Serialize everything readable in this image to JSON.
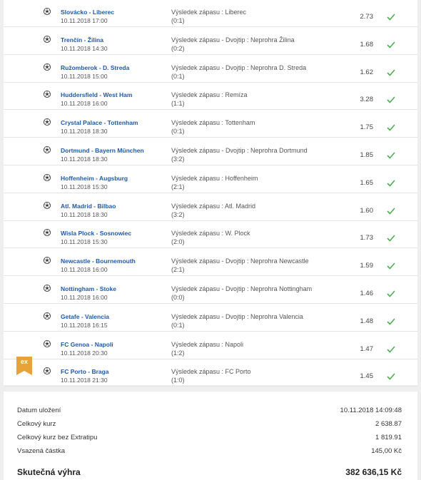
{
  "ticket": {
    "rows": [
      {
        "match": "Slovácko - Liberec",
        "date": "10.11.2018 17:00",
        "bet": "Výsledek zápasu : Liberec",
        "score": "(0:1)",
        "odds": "2.73",
        "extra": false
      },
      {
        "match": "Trenčín - Žilina",
        "date": "10.11.2018 14:30",
        "bet": "Výsledek zápasu - Dvojtip : Neprohra Žilina",
        "score": "(0:2)",
        "odds": "1.68",
        "extra": false
      },
      {
        "match": "Ružomberok - D. Streda",
        "date": "10.11.2018 15:00",
        "bet": "Výsledek zápasu - Dvojtip : Neprohra D. Streda",
        "score": "(0:1)",
        "odds": "1.62",
        "extra": false
      },
      {
        "match": "Huddersfield - West Ham",
        "date": "10.11.2018 16:00",
        "bet": "Výsledek zápasu : Remíza",
        "score": "(1:1)",
        "odds": "3.28",
        "extra": false
      },
      {
        "match": "Crystal Palace - Tottenham",
        "date": "10.11.2018 18:30",
        "bet": "Výsledek zápasu : Tottenham",
        "score": "(0:1)",
        "odds": "1.75",
        "extra": false
      },
      {
        "match": "Dortmund - Bayern München",
        "date": "10.11.2018 18:30",
        "bet": "Výsledek zápasu - Dvojtip : Neprohra Dortmund",
        "score": "(3:2)",
        "odds": "1.85",
        "extra": false
      },
      {
        "match": "Hoffenheim - Augsburg",
        "date": "10.11.2018 15:30",
        "bet": "Výsledek zápasu : Hoffenheim",
        "score": "(2:1)",
        "odds": "1.65",
        "extra": false
      },
      {
        "match": "Atl. Madrid - Bilbao",
        "date": "10.11.2018 18:30",
        "bet": "Výsledek zápasu : Atl. Madrid",
        "score": "(3:2)",
        "odds": "1.60",
        "extra": false
      },
      {
        "match": "Wisla Plock - Sosnowiec",
        "date": "10.11.2018 15:30",
        "bet": "Výsledek zápasu : W. Plock",
        "score": "(2:0)",
        "odds": "1.73",
        "extra": false
      },
      {
        "match": "Newcastle - Bournemouth",
        "date": "10.11.2018 16:00",
        "bet": "Výsledek zápasu - Dvojtip : Neprohra Newcastle",
        "score": "(2:1)",
        "odds": "1.59",
        "extra": false
      },
      {
        "match": "Nottingham - Stoke",
        "date": "10.11.2018 16:00",
        "bet": "Výsledek zápasu - Dvojtip : Neprohra Nottingham",
        "score": "(0:0)",
        "odds": "1.46",
        "extra": false
      },
      {
        "match": "Getafe - Valencia",
        "date": "10.11.2018 16:15",
        "bet": "Výsledek zápasu - Dvojtip : Neprohra Valencia",
        "score": "(0:1)",
        "odds": "1.48",
        "extra": false
      },
      {
        "match": "FC Genoa - Napoli",
        "date": "10.11.2018 20:30",
        "bet": "Výsledek zápasu : Napoli",
        "score": "(1:2)",
        "odds": "1.47",
        "extra": false
      },
      {
        "match": "FC Porto - Braga",
        "date": "10.11.2018 21:30",
        "bet": "Výsledek zápasu : FC Porto",
        "score": "(1:0)",
        "odds": "1.45",
        "extra": true
      }
    ],
    "extra_badge_label": "ex"
  },
  "summary": {
    "saved_label": "Datum uložení",
    "saved_value": "10.11.2018 14:09:48",
    "total_odds_label": "Celkový kurz",
    "total_odds_value": "2 638.87",
    "odds_no_extra_label": "Celkový kurz bez Extratipu",
    "odds_no_extra_value": "1 819.91",
    "stake_label": "Vsazená částka",
    "stake_value": "145,00 Kč",
    "win_label": "Skutečná výhra",
    "win_value": "382 636,15 Kč"
  },
  "colors": {
    "match_link": "#1e5aa8",
    "check": "#4caf50",
    "badge": "#e8a23a"
  }
}
